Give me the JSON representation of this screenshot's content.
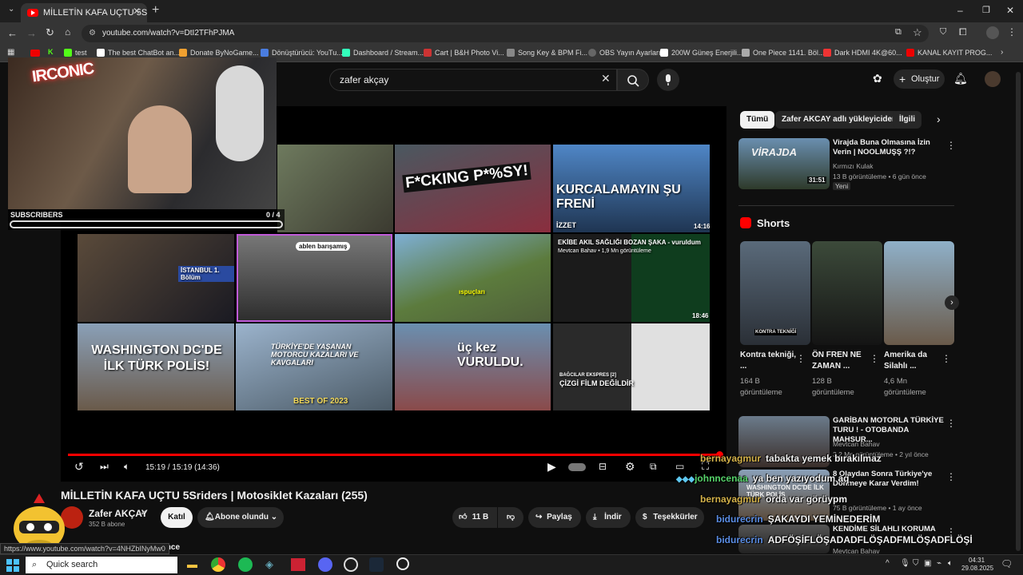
{
  "browser": {
    "tab_title": "MİLLETİN KAFA UÇTU 5Sriders | Moto",
    "url": "youtube.com/watch?v=DtI2TFhPJMA",
    "status_url": "https://www.youtube.com/watch?v=4NHZbINyMw0",
    "bookmarks": [
      "test",
      "The best ChatBot an...",
      "Donate ByNoGame...",
      "Dönüştürücü: YouTu...",
      "Dashboard / Stream...",
      "Cart | B&H Photo Vi...",
      "Song Key & BPM Fi...",
      "OBS Yayın Ayarları",
      "200W Güneş Enerjili...",
      "One Piece 1141. Böl...",
      "Dark HDMI 4K@60...",
      "KANAL KAYIT PROG..."
    ]
  },
  "masthead": {
    "search_value": "zafer akçay",
    "create_label": "Oluştur"
  },
  "player": {
    "time": "15:19 / 15:19 (14:36)",
    "endscreen": [
      {
        "text": "F*CKING P*%SY!",
        "color": "#c0392b"
      },
      {
        "text": "KURCALAMAYIN ŞU FRENİ",
        "label": "İZZET",
        "duration": "14:16"
      },
      {
        "text": "İSTANBUL 1. Bölüm"
      },
      {
        "text": "ablen barışamış"
      },
      {
        "text": "ıspuçları"
      },
      {
        "text": "EKİBE AKIL SAĞLIĞI BOZAN ŞAKA - vuruldum",
        "sub": "Mevtcan Bahav • 1,9 Mn görüntüleme",
        "duration": "18:46"
      },
      {
        "text": "WASHINGTON DC'DE İLK TÜRK POLİS!"
      },
      {
        "text": "TÜRKİYE'DE YAŞANAN MOTORCU KAZALARI VE KAVGALARI",
        "sub": "BEST OF 2023"
      },
      {
        "text": "üç kez VURULDU."
      },
      {
        "text": "ÇİZGİ FİLM DEĞİLDİR",
        "sub": "BAĞCILAR EKSPRES [2]"
      }
    ]
  },
  "video": {
    "title": "MİLLETİN KAFA UÇTU 5Sriders | Motosiklet Kazaları (255)",
    "channel": "Zafer AKÇAY",
    "subscribers": "352 B abone",
    "join_label": "Katıl",
    "subscribed_label": "Abone olundu",
    "likes": "11 B",
    "share_label": "Paylaş",
    "download_label": "İndir",
    "thanks_label": "Teşekkürler",
    "time_ago": "in önce"
  },
  "sidebar": {
    "chips": [
      "Tümü",
      "Zafer AKCAY adlı yükleyiciden",
      "İlgili"
    ],
    "top_rec": {
      "title": "Virajda Buna Olmasına İzin Verin | NOOLMUŞŞ ?!?",
      "channel": "Kırmızı Kulak",
      "meta": "13 B görüntüleme • 6 gün önce",
      "badge": "Yeni",
      "duration": "31:51",
      "thumb_text": "VİRAJDA"
    },
    "shorts_title": "Shorts",
    "shorts": [
      {
        "title": "Kontra tekniği, ...",
        "views": "164 B görüntüleme",
        "overlay": "KONTRA TEKNİĞİ"
      },
      {
        "title": "ÖN FREN NE ZAMAN ...",
        "views": "128 B görüntüleme"
      },
      {
        "title": "Amerika da Silahlı ...",
        "views": "4,6 Mn görüntüleme"
      }
    ],
    "recs": [
      {
        "title": "GARİBAN MOTORLA TÜRKİYE TURU ! - OTOBANDA MAHSUR...",
        "channel": "Mevtcan Bahav",
        "meta": "3,2 Mn görüntüleme • 2 yıl önce"
      },
      {
        "title": "8 Olaydan Sonra Türkiye'ye Dönmeye Karar Verdim!",
        "channel": "",
        "meta": "75 B görüntüleme • 1 ay önce",
        "thumb_text": "WASHINGTON DC'DE İLK TÜRK POLİS"
      },
      {
        "title": "KENDİME SİLAHLI KORUMA",
        "channel": "Mevtcan Bahav",
        "meta": ""
      }
    ]
  },
  "overlay": {
    "logo_text": "IRCONIC",
    "subs_label": "SUBSCRIBERS",
    "subs_count": "0 / 4",
    "subs_progress": 0,
    "chat": [
      {
        "user": "bernayagmur",
        "msg": "tabakta yemek bırakılmaz",
        "user_color": "#d4b24a"
      },
      {
        "user": "johnncenaa",
        "msg": "ya ben yazıyodum aq",
        "user_color": "#56d36a"
      },
      {
        "user": "bernayagmur",
        "msg": "orda var görüypm",
        "user_color": "#d4b24a"
      },
      {
        "user": "bidurecrin",
        "msg": "ŞAKAYDI YEMİNEDERİM",
        "user_color": "#5b8ee6"
      },
      {
        "user": "bidurecrin",
        "msg": "ADFÖŞİFLÖŞADADFLÖŞADFMLÖŞADFLÖŞİ",
        "user_color": "#5b8ee6"
      }
    ]
  },
  "taskbar": {
    "search_placeholder": "Quick search",
    "time": "04:31",
    "date": "29.08.2025"
  }
}
